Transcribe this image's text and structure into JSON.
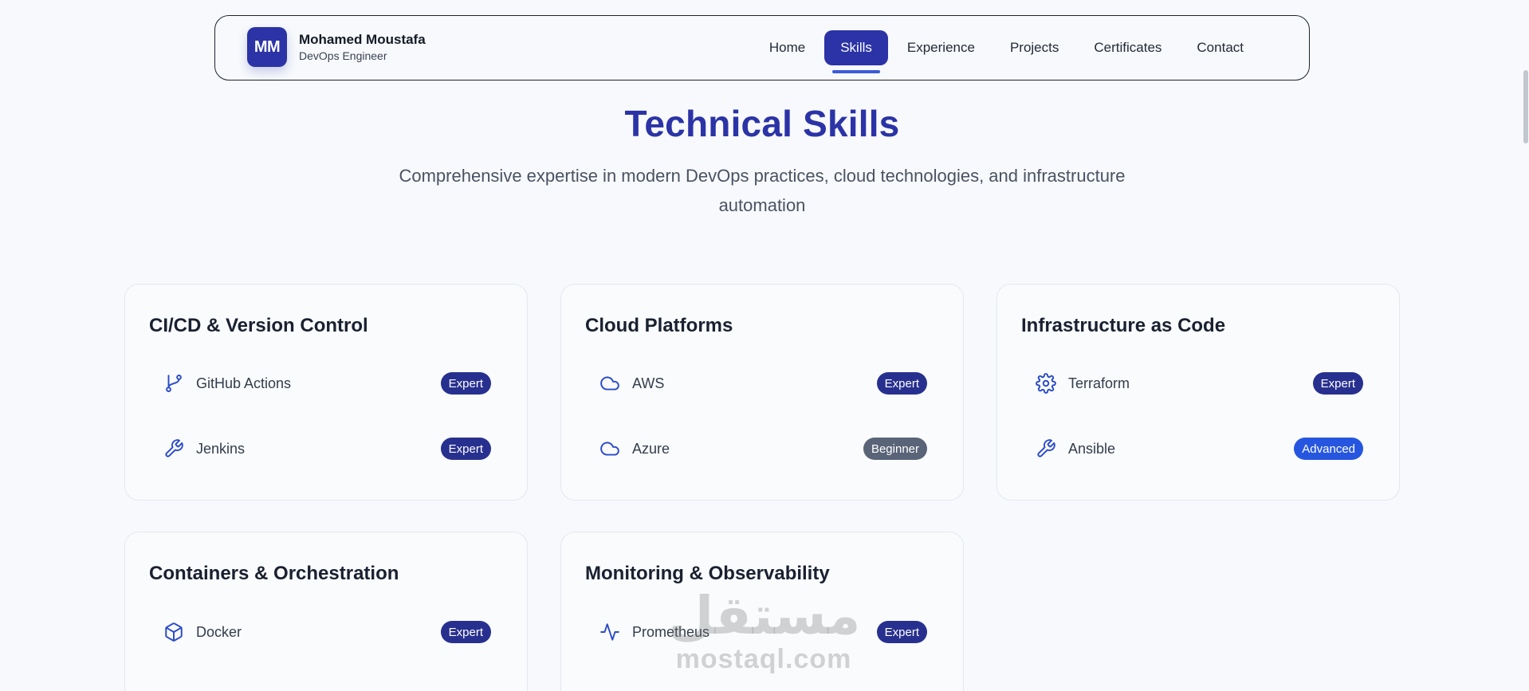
{
  "brand": {
    "initials": "MM",
    "name": "Mohamed Moustafa",
    "role": "DevOps Engineer"
  },
  "nav": {
    "items": [
      {
        "label": "Home"
      },
      {
        "label": "Skills",
        "active": true
      },
      {
        "label": "Experience"
      },
      {
        "label": "Projects"
      },
      {
        "label": "Certificates"
      },
      {
        "label": "Contact"
      }
    ]
  },
  "section": {
    "title": "Technical Skills",
    "subtitle": "Comprehensive expertise in modern DevOps practices, cloud technologies, and infrastructure automation"
  },
  "cards": [
    {
      "title": "CI/CD & Version Control",
      "skills": [
        {
          "name": "GitHub Actions",
          "icon": "git-branch-icon",
          "level": "Expert"
        },
        {
          "name": "Jenkins",
          "icon": "wrench-icon",
          "level": "Expert"
        }
      ]
    },
    {
      "title": "Cloud Platforms",
      "skills": [
        {
          "name": "AWS",
          "icon": "cloud-icon",
          "level": "Expert"
        },
        {
          "name": "Azure",
          "icon": "cloud-icon",
          "level": "Beginner"
        }
      ]
    },
    {
      "title": "Infrastructure as Code",
      "skills": [
        {
          "name": "Terraform",
          "icon": "gear-icon",
          "level": "Expert"
        },
        {
          "name": "Ansible",
          "icon": "wrench-icon",
          "level": "Advanced"
        }
      ]
    },
    {
      "title": "Containers & Orchestration",
      "skills": [
        {
          "name": "Docker",
          "icon": "box-icon",
          "level": "Expert"
        }
      ]
    },
    {
      "title": "Monitoring & Observability",
      "skills": [
        {
          "name": "Prometheus",
          "icon": "activity-icon",
          "level": "Expert"
        }
      ]
    }
  ],
  "watermark": {
    "arabic": "مستقل",
    "latin": "mostaql.com"
  },
  "colors": {
    "primary": "#2b33a6",
    "icon": "#2b4bc8",
    "badge_expert": "#28308f",
    "badge_beginner": "#5a6478",
    "badge_advanced": "#2656e0",
    "background": "#f7f9fc"
  }
}
